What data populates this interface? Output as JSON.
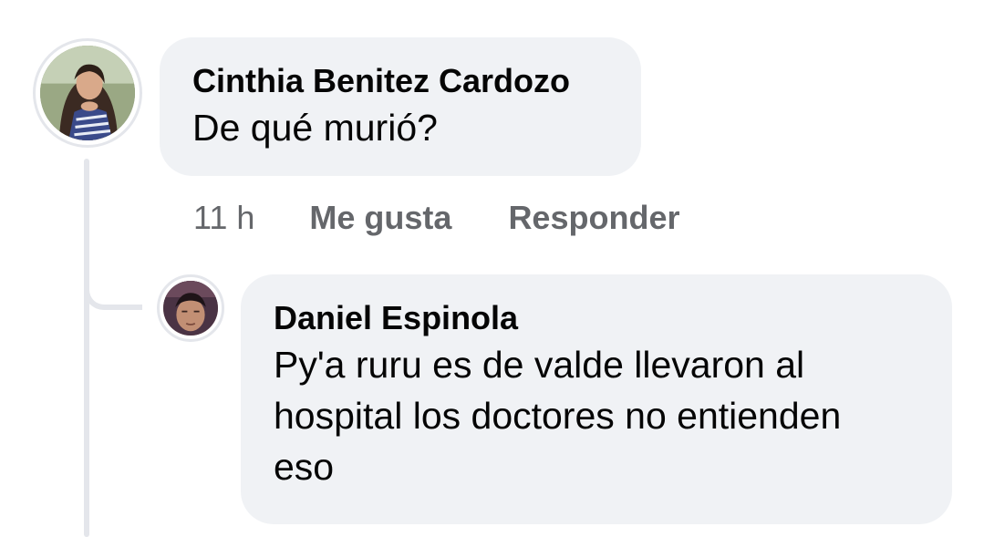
{
  "thread": {
    "comment": {
      "author": "Cinthia Benitez Cardozo",
      "text": "De qué murió?",
      "time": "11 h",
      "like_label": "Me gusta",
      "reply_label": "Responder",
      "avatar_icon": "user-avatar-photo"
    },
    "reply": {
      "author": "Daniel Espinola",
      "text": "Py'a ruru es de valde llevaron al hospital los doctores no entienden eso",
      "avatar_icon": "user-avatar-photo"
    }
  },
  "colors": {
    "bubble_bg": "#f0f2f5",
    "text": "#050505",
    "secondary_text": "#65676b",
    "thread_line": "#e4e6eb"
  }
}
